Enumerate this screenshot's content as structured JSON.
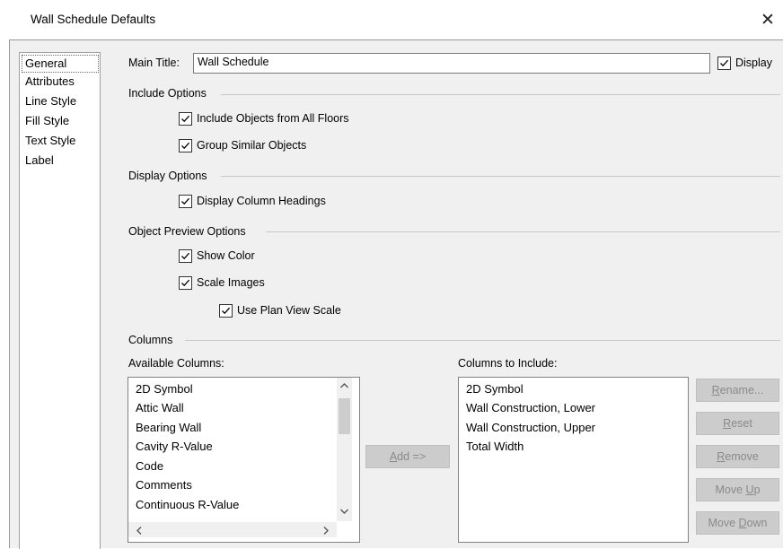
{
  "window": {
    "title": "Wall Schedule Defaults",
    "close_glyph": "✕"
  },
  "nav": {
    "items": [
      "General",
      "Attributes",
      "Line Style",
      "Fill Style",
      "Text Style",
      "Label"
    ]
  },
  "main_title": {
    "label": "Main Title:",
    "value": "Wall Schedule",
    "display_label": "Display",
    "display_checked": true
  },
  "include_options": {
    "header": "Include Options",
    "all_floors": "Include Objects from All Floors",
    "group_similar": "Group Similar Objects"
  },
  "display_options": {
    "header": "Display Options",
    "column_headings": "Display Column Headings"
  },
  "preview_options": {
    "header": "Object Preview Options",
    "show_color": "Show Color",
    "scale_images": "Scale Images",
    "plan_view_scale": "Use Plan View Scale"
  },
  "columns": {
    "header": "Columns",
    "available_label": "Available Columns:",
    "available": [
      "2D Symbol",
      "Attic Wall",
      "Bearing Wall",
      "Cavity R-Value",
      "Code",
      "Comments",
      "Continuous R-Value"
    ],
    "include_label": "Columns to Include:",
    "included": [
      "2D Symbol",
      "Wall Construction, Lower",
      "Wall Construction, Upper",
      "Total Width"
    ]
  },
  "buttons": {
    "add_mnemonic": "A",
    "add_rest": "dd =>",
    "rename_mnemonic": "R",
    "rename_rest": "ename...",
    "reset_mnemonic": "R",
    "reset_rest": "eset",
    "remove_pre": "",
    "remove_mnemonic": "R",
    "remove_rest": "emove",
    "moveup_pre": "Move ",
    "moveup_mnemonic": "U",
    "moveup_rest": "p",
    "movedown_pre": "Move ",
    "movedown_mnemonic": "D",
    "movedown_rest": "own"
  },
  "icons": {
    "check": "check-icon",
    "scroll_up": "chevron-up-icon",
    "scroll_down": "chevron-down-icon",
    "scroll_left": "chevron-left-icon",
    "scroll_right": "chevron-right-icon"
  }
}
